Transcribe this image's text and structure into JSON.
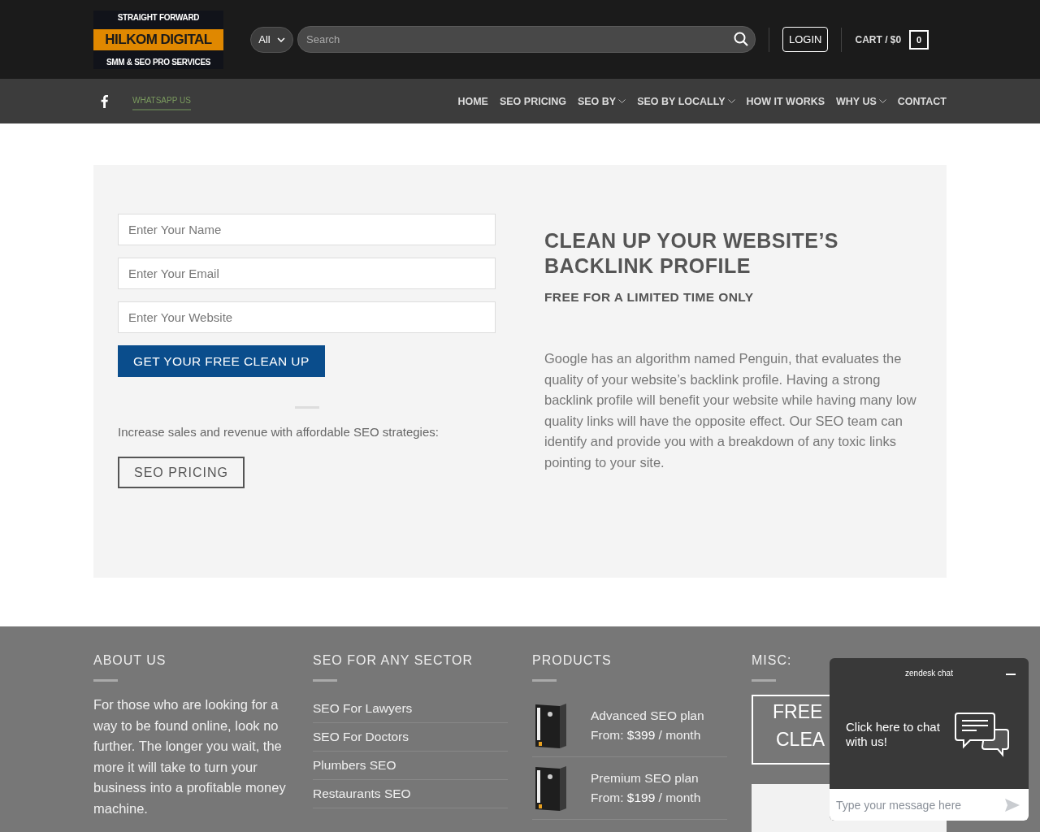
{
  "logo": {
    "top": "STRAIGHT FORWARD",
    "main": "HILKOM DIGITAL",
    "bottom": "SMM & SEO PRO SERVICES"
  },
  "header": {
    "category": "All",
    "search_placeholder": "Search",
    "login": "LOGIN",
    "cart": "CART / $0",
    "cart_count": "0"
  },
  "topbar": {
    "whatsapp": "WHATSAPP US"
  },
  "nav": [
    {
      "label": "HOME",
      "dropdown": false
    },
    {
      "label": "SEO PRICING",
      "dropdown": false
    },
    {
      "label": "SEO BY",
      "dropdown": true
    },
    {
      "label": "SEO BY LOCALLY",
      "dropdown": true
    },
    {
      "label": "HOW IT WORKS",
      "dropdown": false
    },
    {
      "label": "WHY US",
      "dropdown": true
    },
    {
      "label": "CONTACT",
      "dropdown": false
    }
  ],
  "form": {
    "fields": [
      {
        "placeholder": "Enter Your Name"
      },
      {
        "placeholder": "Enter Your Email"
      },
      {
        "placeholder": "Enter Your Website"
      }
    ],
    "submit": "GET YOUR FREE CLEAN UP",
    "tagline": "Increase sales and revenue with affordable SEO strategies:",
    "pricing_button": "SEO PRICING"
  },
  "promo": {
    "title": "CLEAN UP YOUR WEBSITE’S BACKLINK PROFILE",
    "subtitle": "FREE FOR A LIMITED TIME ONLY",
    "body": "Google has an algorithm named Penguin, that evaluates the quality of your website’s backlink profile. Having a strong backlink profile will benefit your website while having many low quality links will have the opposite effect. Our SEO team can identify and provide you with a breakdown of any toxic links pointing to your site."
  },
  "footer": {
    "about": {
      "title": "ABOUT US",
      "text": "For those who are looking for a way to be found online, look no further. The longer you wait, the more it will take to turn your business into a profitable money machine."
    },
    "sectors": {
      "title": "SEO FOR ANY SECTOR",
      "links": [
        "SEO For Lawyers",
        "SEO For Doctors",
        "Plumbers SEO",
        "Restaurants SEO"
      ]
    },
    "products": {
      "title": "PRODUCTS",
      "items": [
        {
          "name": "Advanced SEO plan",
          "prefix": "From:",
          "price": "$399",
          "suffix": "/ month"
        },
        {
          "name": "Premium SEO plan",
          "prefix": "From:",
          "price": "$199",
          "suffix": "/ month"
        }
      ]
    },
    "misc": {
      "title": "MISC:",
      "banner": [
        "FREE",
        "CLEA"
      ]
    }
  },
  "chat": {
    "title": "zendesk chat",
    "prompt": "Click here to chat with us!",
    "placeholder": "Type your message here"
  }
}
